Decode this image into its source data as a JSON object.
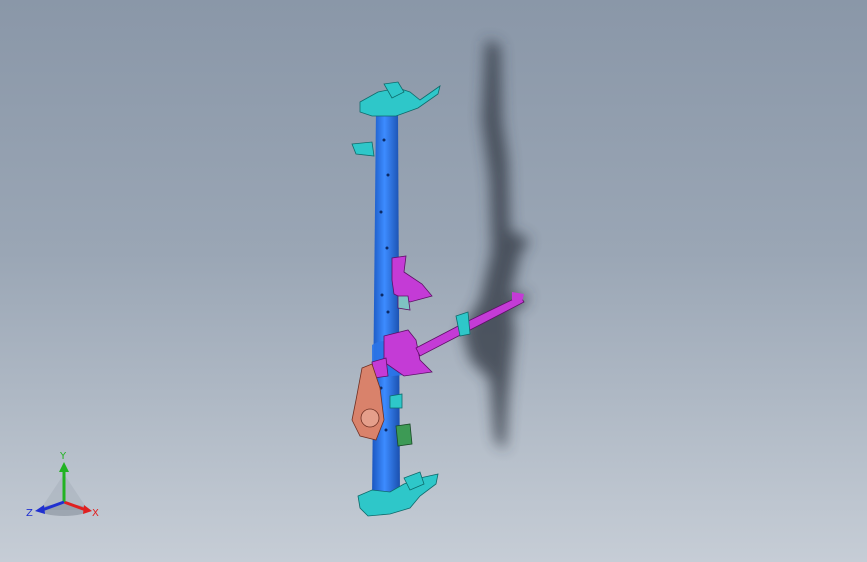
{
  "viewport": {
    "background_top": "#8a97a8",
    "background_bottom": "#c6cdd6"
  },
  "model": {
    "colors": {
      "tube": "#1f6fe0",
      "tube_highlight": "#5aa0ff",
      "bracket_cyan": "#2ec7c9",
      "bracket_magenta": "#c43bd6",
      "bracket_salmon": "#d9826b",
      "bracket_green": "#3d9a55",
      "shadow": "#2f3540"
    }
  },
  "triad": {
    "y_label": "Y",
    "x_label": "X",
    "z_label": "Z",
    "colors": {
      "x": "#e02020",
      "y": "#22b322",
      "z": "#2030d0"
    }
  }
}
